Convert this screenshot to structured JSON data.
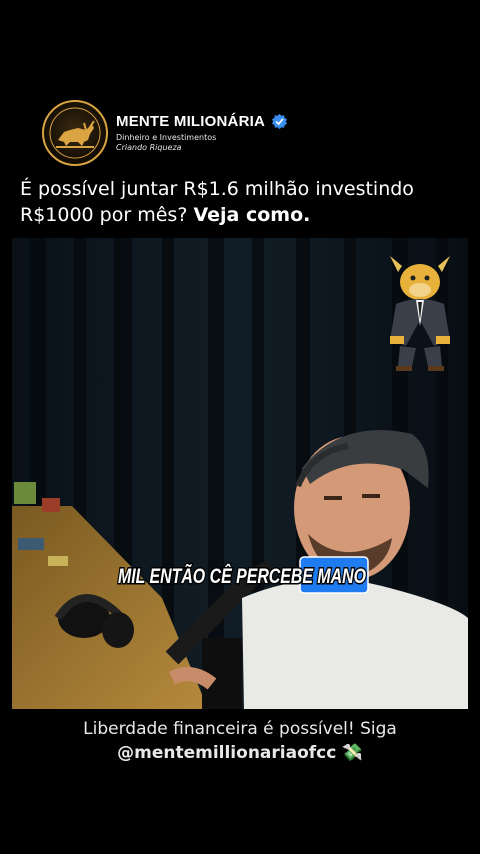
{
  "profile": {
    "name": "MENTE MILIONÁRIA",
    "tagline_1": "Dinheiro e Investimentos",
    "tagline_2": "Criando Riqueza"
  },
  "headline": {
    "text": "É possível juntar R$1.6 milhão investindo R$1000 por mês?",
    "emphasis": "Veja como."
  },
  "video": {
    "subtitle": "MIL ENTÃO CÊ PERCEBE MANO",
    "highlight_word": "MANO"
  },
  "caption": {
    "line_1": "Liberdade financeira é possível! Siga",
    "handle": "@mentemillionariaofcc",
    "emoji": "💸"
  },
  "colors": {
    "background": "#000000",
    "gold": "#d9a441",
    "verified": "#3a8ef0",
    "subtitle_highlight": "#1e7cf0"
  },
  "icons": {
    "avatar": "bull-logo-icon",
    "verified": "verified-badge-icon",
    "mascot": "bull-businessman-icon"
  }
}
